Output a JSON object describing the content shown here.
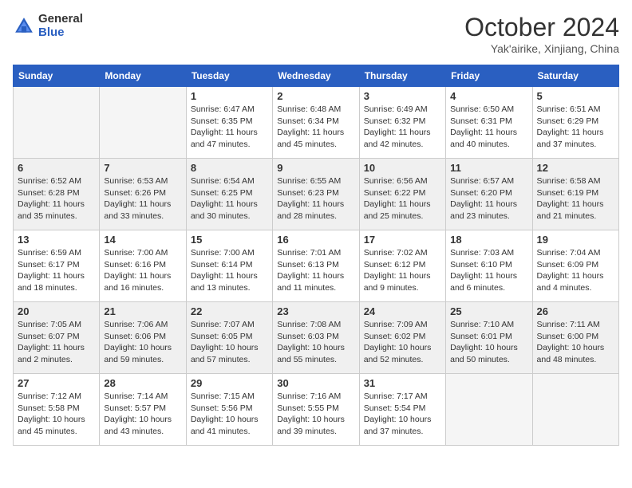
{
  "header": {
    "logo_general": "General",
    "logo_blue": "Blue",
    "month_title": "October 2024",
    "location": "Yak'airike, Xinjiang, China"
  },
  "weekdays": [
    "Sunday",
    "Monday",
    "Tuesday",
    "Wednesday",
    "Thursday",
    "Friday",
    "Saturday"
  ],
  "weeks": [
    [
      {
        "day": "",
        "sunrise": "",
        "sunset": "",
        "daylight": "",
        "empty": true
      },
      {
        "day": "",
        "sunrise": "",
        "sunset": "",
        "daylight": "",
        "empty": true
      },
      {
        "day": "1",
        "sunrise": "Sunrise: 6:47 AM",
        "sunset": "Sunset: 6:35 PM",
        "daylight": "Daylight: 11 hours and 47 minutes."
      },
      {
        "day": "2",
        "sunrise": "Sunrise: 6:48 AM",
        "sunset": "Sunset: 6:34 PM",
        "daylight": "Daylight: 11 hours and 45 minutes."
      },
      {
        "day": "3",
        "sunrise": "Sunrise: 6:49 AM",
        "sunset": "Sunset: 6:32 PM",
        "daylight": "Daylight: 11 hours and 42 minutes."
      },
      {
        "day": "4",
        "sunrise": "Sunrise: 6:50 AM",
        "sunset": "Sunset: 6:31 PM",
        "daylight": "Daylight: 11 hours and 40 minutes."
      },
      {
        "day": "5",
        "sunrise": "Sunrise: 6:51 AM",
        "sunset": "Sunset: 6:29 PM",
        "daylight": "Daylight: 11 hours and 37 minutes."
      }
    ],
    [
      {
        "day": "6",
        "sunrise": "Sunrise: 6:52 AM",
        "sunset": "Sunset: 6:28 PM",
        "daylight": "Daylight: 11 hours and 35 minutes."
      },
      {
        "day": "7",
        "sunrise": "Sunrise: 6:53 AM",
        "sunset": "Sunset: 6:26 PM",
        "daylight": "Daylight: 11 hours and 33 minutes."
      },
      {
        "day": "8",
        "sunrise": "Sunrise: 6:54 AM",
        "sunset": "Sunset: 6:25 PM",
        "daylight": "Daylight: 11 hours and 30 minutes."
      },
      {
        "day": "9",
        "sunrise": "Sunrise: 6:55 AM",
        "sunset": "Sunset: 6:23 PM",
        "daylight": "Daylight: 11 hours and 28 minutes."
      },
      {
        "day": "10",
        "sunrise": "Sunrise: 6:56 AM",
        "sunset": "Sunset: 6:22 PM",
        "daylight": "Daylight: 11 hours and 25 minutes."
      },
      {
        "day": "11",
        "sunrise": "Sunrise: 6:57 AM",
        "sunset": "Sunset: 6:20 PM",
        "daylight": "Daylight: 11 hours and 23 minutes."
      },
      {
        "day": "12",
        "sunrise": "Sunrise: 6:58 AM",
        "sunset": "Sunset: 6:19 PM",
        "daylight": "Daylight: 11 hours and 21 minutes."
      }
    ],
    [
      {
        "day": "13",
        "sunrise": "Sunrise: 6:59 AM",
        "sunset": "Sunset: 6:17 PM",
        "daylight": "Daylight: 11 hours and 18 minutes."
      },
      {
        "day": "14",
        "sunrise": "Sunrise: 7:00 AM",
        "sunset": "Sunset: 6:16 PM",
        "daylight": "Daylight: 11 hours and 16 minutes."
      },
      {
        "day": "15",
        "sunrise": "Sunrise: 7:00 AM",
        "sunset": "Sunset: 6:14 PM",
        "daylight": "Daylight: 11 hours and 13 minutes."
      },
      {
        "day": "16",
        "sunrise": "Sunrise: 7:01 AM",
        "sunset": "Sunset: 6:13 PM",
        "daylight": "Daylight: 11 hours and 11 minutes."
      },
      {
        "day": "17",
        "sunrise": "Sunrise: 7:02 AM",
        "sunset": "Sunset: 6:12 PM",
        "daylight": "Daylight: 11 hours and 9 minutes."
      },
      {
        "day": "18",
        "sunrise": "Sunrise: 7:03 AM",
        "sunset": "Sunset: 6:10 PM",
        "daylight": "Daylight: 11 hours and 6 minutes."
      },
      {
        "day": "19",
        "sunrise": "Sunrise: 7:04 AM",
        "sunset": "Sunset: 6:09 PM",
        "daylight": "Daylight: 11 hours and 4 minutes."
      }
    ],
    [
      {
        "day": "20",
        "sunrise": "Sunrise: 7:05 AM",
        "sunset": "Sunset: 6:07 PM",
        "daylight": "Daylight: 11 hours and 2 minutes."
      },
      {
        "day": "21",
        "sunrise": "Sunrise: 7:06 AM",
        "sunset": "Sunset: 6:06 PM",
        "daylight": "Daylight: 10 hours and 59 minutes."
      },
      {
        "day": "22",
        "sunrise": "Sunrise: 7:07 AM",
        "sunset": "Sunset: 6:05 PM",
        "daylight": "Daylight: 10 hours and 57 minutes."
      },
      {
        "day": "23",
        "sunrise": "Sunrise: 7:08 AM",
        "sunset": "Sunset: 6:03 PM",
        "daylight": "Daylight: 10 hours and 55 minutes."
      },
      {
        "day": "24",
        "sunrise": "Sunrise: 7:09 AM",
        "sunset": "Sunset: 6:02 PM",
        "daylight": "Daylight: 10 hours and 52 minutes."
      },
      {
        "day": "25",
        "sunrise": "Sunrise: 7:10 AM",
        "sunset": "Sunset: 6:01 PM",
        "daylight": "Daylight: 10 hours and 50 minutes."
      },
      {
        "day": "26",
        "sunrise": "Sunrise: 7:11 AM",
        "sunset": "Sunset: 6:00 PM",
        "daylight": "Daylight: 10 hours and 48 minutes."
      }
    ],
    [
      {
        "day": "27",
        "sunrise": "Sunrise: 7:12 AM",
        "sunset": "Sunset: 5:58 PM",
        "daylight": "Daylight: 10 hours and 45 minutes."
      },
      {
        "day": "28",
        "sunrise": "Sunrise: 7:14 AM",
        "sunset": "Sunset: 5:57 PM",
        "daylight": "Daylight: 10 hours and 43 minutes."
      },
      {
        "day": "29",
        "sunrise": "Sunrise: 7:15 AM",
        "sunset": "Sunset: 5:56 PM",
        "daylight": "Daylight: 10 hours and 41 minutes."
      },
      {
        "day": "30",
        "sunrise": "Sunrise: 7:16 AM",
        "sunset": "Sunset: 5:55 PM",
        "daylight": "Daylight: 10 hours and 39 minutes."
      },
      {
        "day": "31",
        "sunrise": "Sunrise: 7:17 AM",
        "sunset": "Sunset: 5:54 PM",
        "daylight": "Daylight: 10 hours and 37 minutes."
      },
      {
        "day": "",
        "sunrise": "",
        "sunset": "",
        "daylight": "",
        "empty": true
      },
      {
        "day": "",
        "sunrise": "",
        "sunset": "",
        "daylight": "",
        "empty": true
      }
    ]
  ]
}
